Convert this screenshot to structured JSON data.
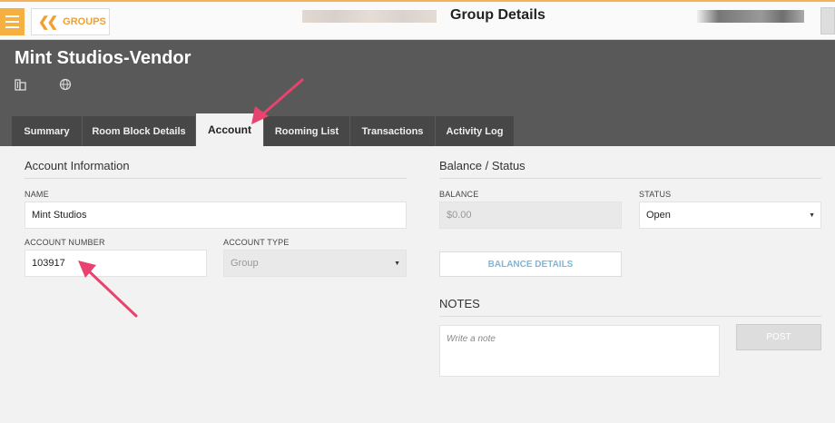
{
  "topbar": {
    "groups_label": "GROUPS",
    "page_title": "Group Details"
  },
  "header": {
    "group_name": "Mint Studios-Vendor"
  },
  "tabs": [
    {
      "label": "Summary"
    },
    {
      "label": "Room Block Details"
    },
    {
      "label": "Account"
    },
    {
      "label": "Rooming List"
    },
    {
      "label": "Transactions"
    },
    {
      "label": "Activity Log"
    }
  ],
  "active_tab": "Account",
  "account_info": {
    "title": "Account Information",
    "name_label": "NAME",
    "name_value": "Mint Studios",
    "account_number_label": "ACCOUNT NUMBER",
    "account_number_value": "103917",
    "account_type_label": "ACCOUNT TYPE",
    "account_type_value": "Group"
  },
  "balance_status": {
    "title": "Balance / Status",
    "balance_label": "BALANCE",
    "balance_value": "$0.00",
    "status_label": "STATUS",
    "status_value": "Open",
    "balance_details_label": "BALANCE DETAILS"
  },
  "notes": {
    "title": "NOTES",
    "placeholder": "Write a note",
    "post_label": "POST"
  },
  "colors": {
    "accent": "#f5b041",
    "header_bg": "#595959",
    "tab_bg": "#474747",
    "annotation_arrow": "#e8426f"
  },
  "icons": [
    "menu-icon",
    "double-chevron-left-icon",
    "building-icon",
    "globe-icon",
    "caret-down-icon"
  ]
}
